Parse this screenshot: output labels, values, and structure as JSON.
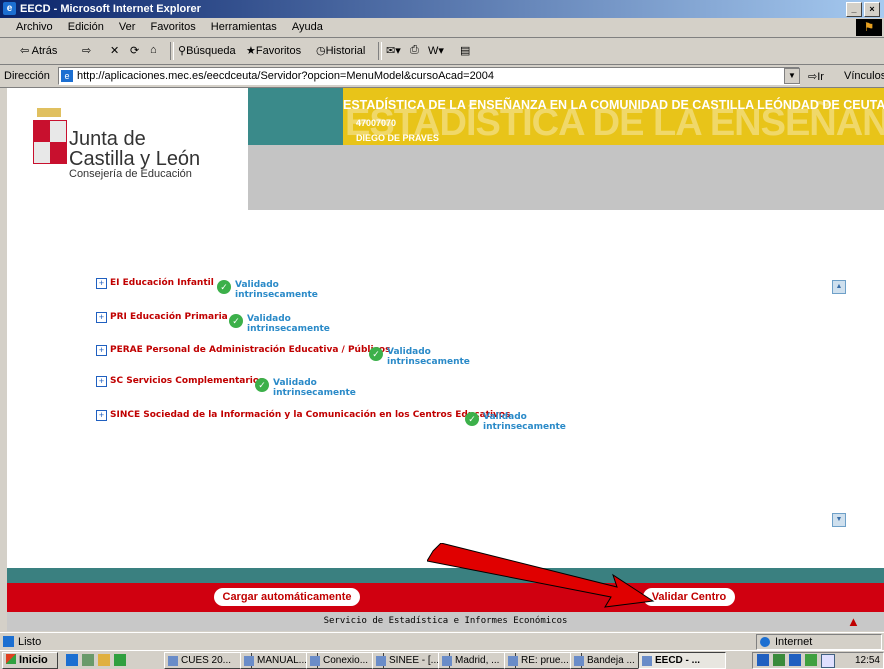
{
  "window": {
    "title": "EECD - Microsoft Internet Explorer",
    "controls": [
      "_",
      "×"
    ]
  },
  "menu": [
    "Archivo",
    "Edición",
    "Ver",
    "Favoritos",
    "Herramientas",
    "Ayuda"
  ],
  "toolbar": {
    "back": "⇦ Atrás",
    "search": "Búsqueda",
    "favorites": "Favoritos",
    "history": "Historial"
  },
  "address": {
    "label": "Dirección",
    "url": "http://aplicaciones.mec.es/eecdceuta/Servidor?opcion=MenuModel&cursoAcad=2004",
    "go": "Ir",
    "links": "Vínculos"
  },
  "logo": {
    "line1": "Junta de",
    "line2": "Castilla y León",
    "line3": "Consejería de Educación"
  },
  "header": {
    "title": "ESTADÍSTICA DE LA ENSEÑANZA EN LA COMUNIDAD DE CASTILLA LEÓNDAD DE CEUTA",
    "code": "47007070",
    "center": "DIEGO DE PRAVES",
    "accent_yellow": "#e8c419",
    "accent_teal": "#3a8a8a"
  },
  "sections": [
    {
      "name": "EI Educación Infantil",
      "status1": "Validado",
      "status2": "intrinsecamente"
    },
    {
      "name": "PRI Educación Primaria",
      "status1": "Validado",
      "status2": "intrinsecamente"
    },
    {
      "name": "PERAE Personal de Administración Educativa / Públicos",
      "status1": "Validado",
      "status2": "intrinsecamente"
    },
    {
      "name": "SC Servicios Complementarios",
      "status1": "Validado",
      "status2": "intrinsecamente"
    },
    {
      "name": "SINCE Sociedad de la Información y la Comunicación en los Centros Educativos",
      "status1": "Validado",
      "status2": "intrinsecamente"
    }
  ],
  "actions": {
    "load": "Cargar automáticamente",
    "validate": "Validar Centro"
  },
  "footer": "Servicio de Estadística e Informes Económicos",
  "status": {
    "text": "Listo",
    "zone": "Internet"
  },
  "taskbar": {
    "start": "Inicio",
    "items": [
      "CUES 20...",
      "MANUAL...",
      "Conexio...",
      "SINEE - [...",
      "Madrid, ...",
      "RE: prue...",
      "Bandeja ...",
      "EECD - ..."
    ],
    "clock": "12:54"
  }
}
